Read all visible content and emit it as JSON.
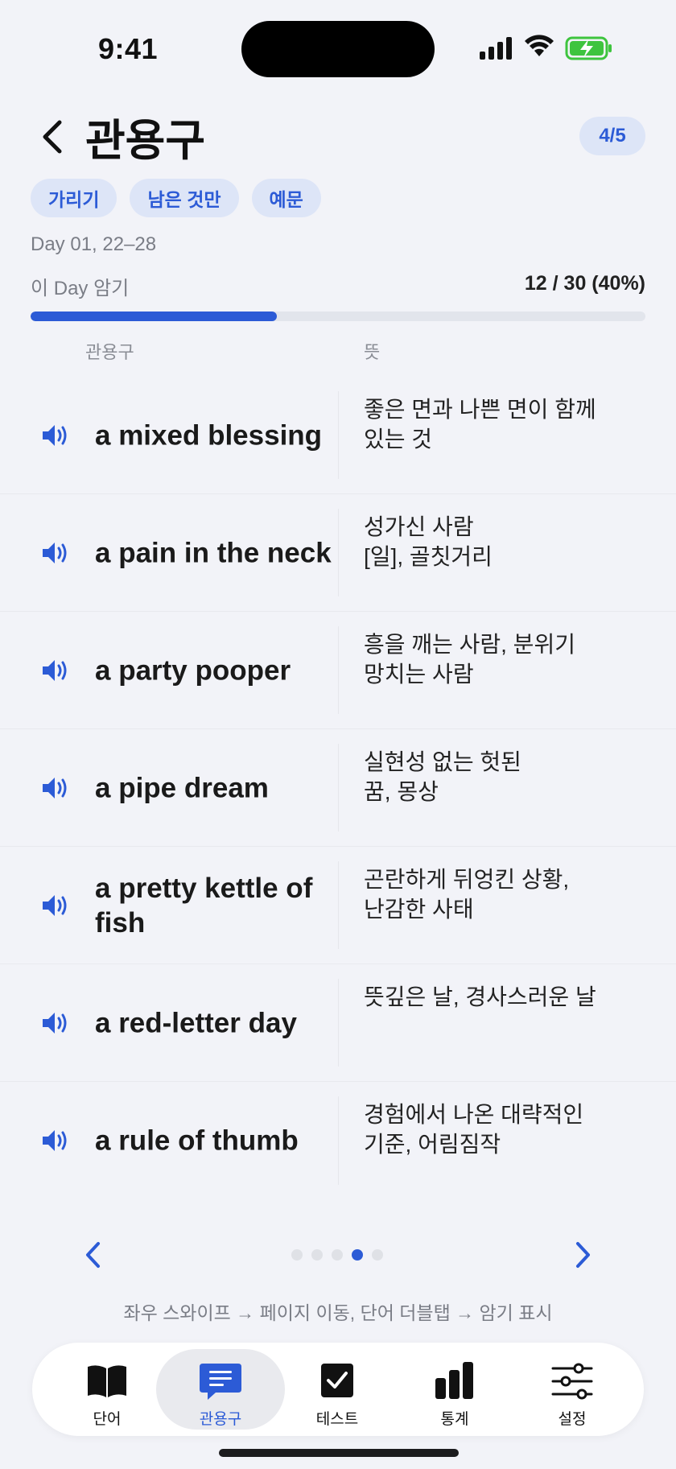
{
  "status_bar": {
    "time": "9:41"
  },
  "header": {
    "title": "관용구",
    "page_badge": "4/5"
  },
  "filters": [
    {
      "label": "가리기"
    },
    {
      "label": "남은 것만"
    },
    {
      "label": "예문"
    }
  ],
  "day_range": "Day 01, 22–28",
  "progress": {
    "label": "이 Day 암기",
    "value_text": "12 / 30 (40%)",
    "fraction": 0.4
  },
  "columns": {
    "phrase": "관용구",
    "meaning": "뜻"
  },
  "phrases": [
    {
      "phrase": "a mixed blessing",
      "meaning": "좋은 면과 나쁜 면이 함께\n있는 것"
    },
    {
      "phrase": "a pain in the neck",
      "meaning": "성가신 사람\n[일], 골칫거리"
    },
    {
      "phrase": "a party pooper",
      "meaning": "흥을 깨는 사람, 분위기\n망치는 사람"
    },
    {
      "phrase": "a pipe dream",
      "meaning": "실현성 없는 헛된\n꿈, 몽상"
    },
    {
      "phrase": "a pretty kettle of fish",
      "meaning": "곤란하게 뒤엉킨 상황,\n난감한 사태"
    },
    {
      "phrase": "a red-letter day",
      "meaning": "뜻깊은 날, 경사스러운 날"
    },
    {
      "phrase": "a rule of thumb",
      "meaning": "경험에서 나온 대략적인\n기준, 어림짐작"
    }
  ],
  "pager": {
    "total_pages": 5,
    "current_page": 4
  },
  "hint": "좌우 스와이프 → 페이지 이동, 단어 더블탭 → 암기 표시",
  "tabs": [
    {
      "label": "단어",
      "icon": "book-icon"
    },
    {
      "label": "관용구",
      "icon": "chat-bubble-icon",
      "active": true
    },
    {
      "label": "테스트",
      "icon": "checkbox-icon"
    },
    {
      "label": "통계",
      "icon": "bar-chart-icon"
    },
    {
      "label": "설정",
      "icon": "sliders-icon"
    }
  ],
  "colors": {
    "accent": "#2c5bd6",
    "chip_bg": "#dde5f7",
    "background": "#f2f3f8"
  }
}
